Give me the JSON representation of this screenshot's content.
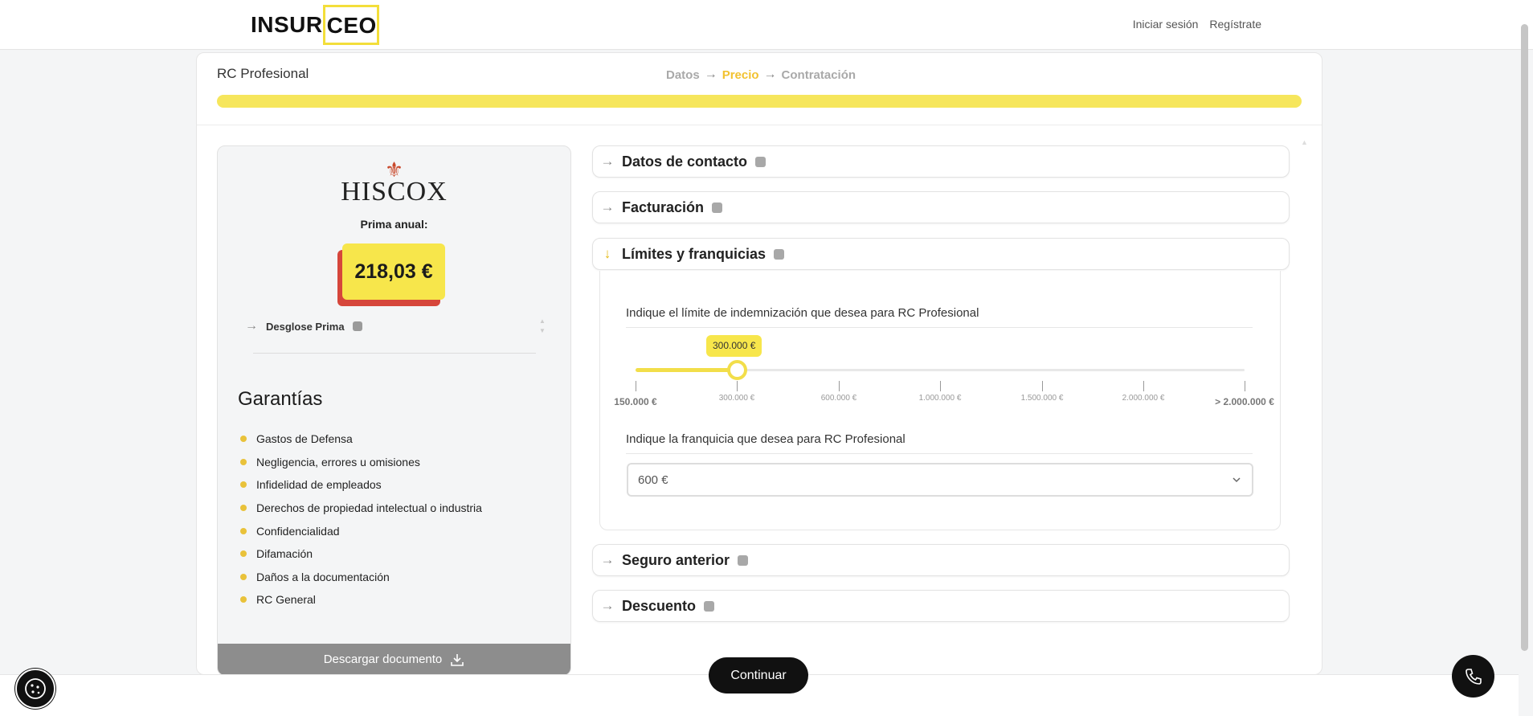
{
  "brand": {
    "logo_prefix": "INSUR",
    "logo_suffix": "CEO",
    "accent": "#f3de3a"
  },
  "nav": {
    "login": "Iniciar sesión",
    "register": "Regístrate"
  },
  "card": {
    "title": "RC Profesional",
    "steps": [
      "Datos",
      "Precio",
      "Contratación"
    ],
    "active_step": "Precio"
  },
  "quote": {
    "insurer": "HISCOX",
    "prima_label": "Prima anual:",
    "price": "218,03 €",
    "desglose": "Desglose Prima",
    "garantias_title": "Garantías",
    "garantias": [
      "Gastos de Defensa",
      "Negligencia, errores u omisiones",
      "Infidelidad de empleados",
      "Derechos de propiedad intelectual o industria",
      "Confidencialidad",
      "Difamación",
      "Daños a la documentación",
      "RC General"
    ],
    "download": "Descargar documento"
  },
  "sections": {
    "contacto": "Datos de contacto",
    "facturacion": "Facturación",
    "limites": "Límites y franquicias",
    "seguro_anterior": "Seguro anterior",
    "descuento": "Descuento"
  },
  "limites": {
    "question_limit": "Indique el límite de indemnización que desea para RC Profesional",
    "slider_value": "300.000 €",
    "slider_ticks": [
      "150.000 €",
      "300.000 €",
      "600.000 €",
      "1.000.000 €",
      "1.500.000 €",
      "2.000.000 €",
      "> 2.000.000 €"
    ],
    "question_franquicia": "Indique la franquicia que desea para RC Profesional",
    "franquicia_value": "600 €"
  },
  "actions": {
    "continue": "Continuar"
  }
}
